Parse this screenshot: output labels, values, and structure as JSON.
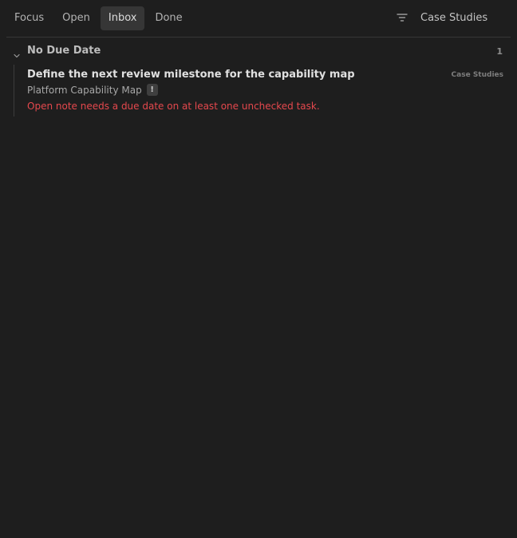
{
  "header": {
    "tabs": [
      {
        "label": "Focus",
        "active": false
      },
      {
        "label": "Open",
        "active": false
      },
      {
        "label": "Inbox",
        "active": true
      },
      {
        "label": "Done",
        "active": false
      }
    ],
    "filter_icon": "filter-icon",
    "filter_label": "Case Studies"
  },
  "group": {
    "chevron_icon": "chevron-down-icon",
    "title": "No Due Date",
    "count": "1"
  },
  "tasks": [
    {
      "title": "Define the next review milestone for the capability map",
      "tag": "Case Studies",
      "note": "Platform Capability Map",
      "flag": "!",
      "warning": "Open note needs a due date on at least one unchecked task."
    }
  ],
  "colors": {
    "background": "#1e1e1e",
    "active_tab": "#363636",
    "warning": "#e5484d"
  }
}
